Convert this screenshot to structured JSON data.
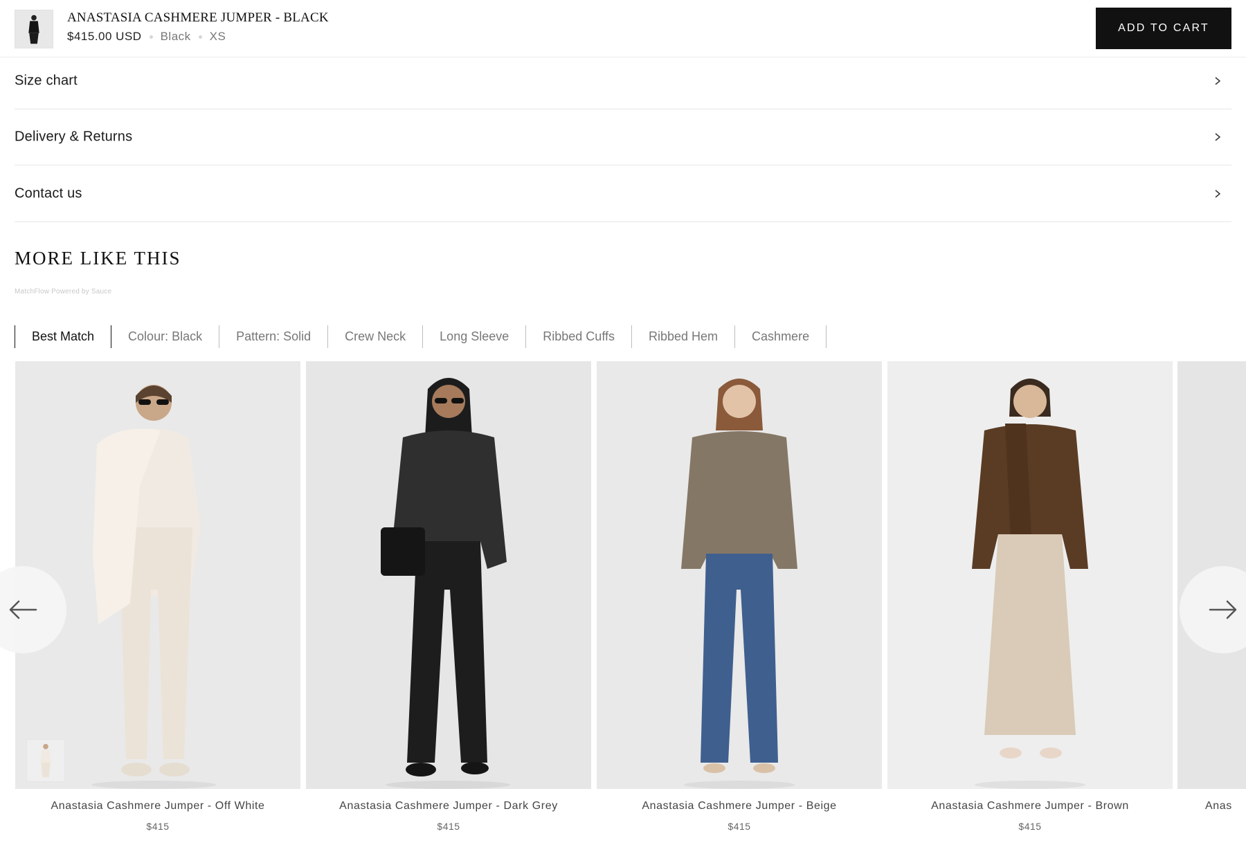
{
  "sticky_bar": {
    "product_title": "ANASTASIA CASHMERE JUMPER - BLACK",
    "price": "$415.00 USD",
    "color": "Black",
    "size": "XS",
    "add_to_cart_label": "ADD TO CART"
  },
  "accordions": [
    {
      "label": "Size chart"
    },
    {
      "label": "Delivery & Returns"
    },
    {
      "label": "Contact us"
    }
  ],
  "more_like_this": {
    "title": "MORE LIKE THIS",
    "powered_by": "MatchFlow Powered by Sauce",
    "filters": [
      {
        "label": "Best Match",
        "active": true
      },
      {
        "label": "Colour: Black",
        "active": false
      },
      {
        "label": "Pattern: Solid",
        "active": false
      },
      {
        "label": "Crew Neck",
        "active": false
      },
      {
        "label": "Long Sleeve",
        "active": false
      },
      {
        "label": "Ribbed Cuffs",
        "active": false
      },
      {
        "label": "Ribbed Hem",
        "active": false
      },
      {
        "label": "Cashmere",
        "active": false
      }
    ],
    "products": [
      {
        "name": "Anastasia Cashmere Jumper - Off White",
        "price": "$415",
        "colors": {
          "top": "#ede5dc",
          "bottom": "#ebe3d8",
          "scarf": "#f3ece4",
          "bg": "#e9e9e9"
        }
      },
      {
        "name": "Anastasia Cashmere Jumper - Dark Grey",
        "price": "$415",
        "colors": {
          "top": "#2e2e2e",
          "bottom": "#1d1d1d",
          "bg": "#e6e6e6"
        }
      },
      {
        "name": "Anastasia Cashmere Jumper - Beige",
        "price": "$415",
        "colors": {
          "top": "#857766",
          "bottom": "#3f5f8e",
          "bg": "#e9e9e9"
        }
      },
      {
        "name": "Anastasia Cashmere Jumper - Brown",
        "price": "$415",
        "colors": {
          "top": "#5a3c24",
          "bottom": "#d9cbb7",
          "scarf": "#4f331d",
          "bg": "#eeeeee"
        }
      },
      {
        "name": "Anas",
        "price": "",
        "colors": {
          "bg": "#e5e5e5"
        }
      }
    ]
  }
}
